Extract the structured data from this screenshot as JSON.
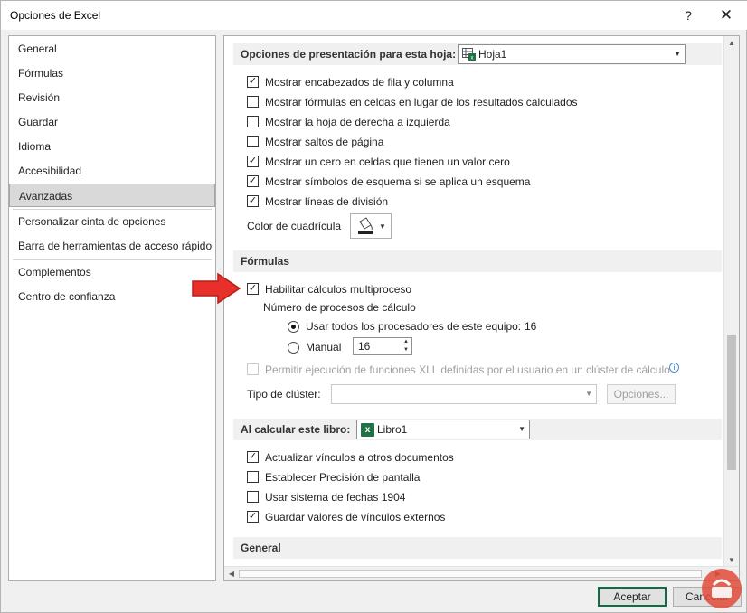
{
  "window": {
    "title": "Opciones de Excel",
    "help_label": "?",
    "close_label": "✕"
  },
  "sidebar": {
    "items": [
      "General",
      "Fórmulas",
      "Revisión",
      "Guardar",
      "Idioma",
      "Accesibilidad",
      "Avanzadas",
      "Personalizar cinta de opciones",
      "Barra de herramientas de acceso rápido",
      "Complementos",
      "Centro de confianza"
    ],
    "selected": "Avanzadas"
  },
  "display_sheet": {
    "header": "Opciones de presentación para esta hoja:",
    "sheet_value": "Hoja1",
    "options": [
      {
        "label": "Mostrar encabezados de fila y columna",
        "checked": true
      },
      {
        "label": "Mostrar fórmulas en celdas en lugar de los resultados calculados",
        "checked": false
      },
      {
        "label": "Mostrar la hoja de derecha a izquierda",
        "checked": false
      },
      {
        "label": "Mostrar saltos de página",
        "checked": false
      },
      {
        "label": "Mostrar un cero en celdas que tienen un valor cero",
        "checked": true
      },
      {
        "label": "Mostrar símbolos de esquema si se aplica un esquema",
        "checked": true
      },
      {
        "label": "Mostrar líneas de división",
        "checked": true
      }
    ],
    "grid_color_label": "Color de cuadrícula"
  },
  "formulas": {
    "header": "Fórmulas",
    "multithread_label": "Habilitar cálculos multiproceso",
    "multithread_checked": true,
    "threads_label": "Número de procesos de cálculo",
    "use_all_label": "Usar todos los procesadores de este equipo:",
    "use_all_value": "16",
    "manual_label": "Manual",
    "manual_value": "16",
    "xll_label": "Permitir ejecución de funciones XLL definidas por el usuario en un clúster de cálculo",
    "cluster_type_label": "Tipo de clúster:",
    "options_button": "Opciones..."
  },
  "calc_book": {
    "header": "Al calcular este libro:",
    "book_value": "Libro1",
    "options": [
      {
        "label": "Actualizar vínculos a otros documentos",
        "checked": true
      },
      {
        "label": "Establecer Precisión de pantalla",
        "checked": false
      },
      {
        "label": "Usar sistema de fechas 1904",
        "checked": false
      },
      {
        "label": "Guardar valores de vínculos externos",
        "checked": true
      }
    ]
  },
  "general_section": {
    "header": "General"
  },
  "footer": {
    "ok_label": "Aceptar",
    "cancel_label": "Cancelar"
  },
  "colors": {
    "accent": "#1f7244",
    "arrow": "#e8302a",
    "selected_nav": "#d9d9d9"
  }
}
